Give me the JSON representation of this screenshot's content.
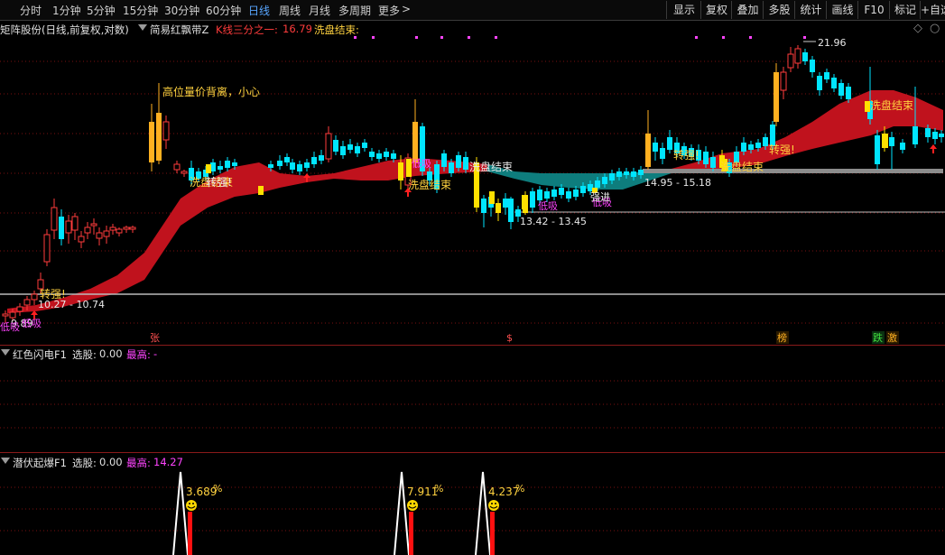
{
  "toolbar": {
    "periods": [
      "分时",
      "1分钟",
      "5分钟",
      "15分钟",
      "30分钟",
      "60分钟",
      "日线",
      "周线",
      "月线",
      "多周期",
      "更多"
    ],
    "active_period": "日线",
    "more_arrow": ">",
    "buttons": [
      "显示",
      "复权",
      "叠加",
      "多股",
      "统计",
      "画线",
      "F10",
      "标记",
      "+自选"
    ]
  },
  "main_panel": {
    "stock_title": "矩阵股份(日线,前复权,对数)",
    "indicator_name": "简易红飘带Z",
    "param1_label": "K线三分之一:",
    "param1_value": "16.79",
    "param2_label": "洗盘结束:",
    "price_labels": [
      "21.96",
      "14.95 - 15.18",
      "13.42 - 13.45",
      "10.27 - 10.74",
      "9.89"
    ],
    "annotations": [
      "高位量价背离，小心",
      "洗盘结束",
      "洗盘结束",
      "洗盘结束",
      "洗盘结束",
      "洗盘结束",
      "转强!",
      "转强!",
      "转强!",
      "转强!",
      "低吸",
      "低吸",
      "低吸",
      "低吸",
      "强进",
      "低吸"
    ],
    "events": [
      "张",
      "$",
      "榜",
      "跌",
      "激"
    ]
  },
  "panel2": {
    "name": "红色闪电F1",
    "select_label": "选股:",
    "select_value": "0.00",
    "max_label": "最高:",
    "max_value": "-"
  },
  "panel3": {
    "name": "潜伏起爆F1",
    "select_label": "选股:",
    "select_value": "0.00",
    "max_label": "最高:",
    "max_value": "14.27",
    "spikes": [
      "3.689",
      "7.911",
      "4.237"
    ],
    "pct": "%"
  },
  "colors": {
    "up_candle": "#ff3c3c",
    "down_candle": "#00e5ff",
    "ribbon_red": "#c0121d",
    "ribbon_teal": "#0e7d7d",
    "accent_yellow": "#ffd23f",
    "magenta": "#ff44ff",
    "active_tab": "#58a6ff"
  }
}
